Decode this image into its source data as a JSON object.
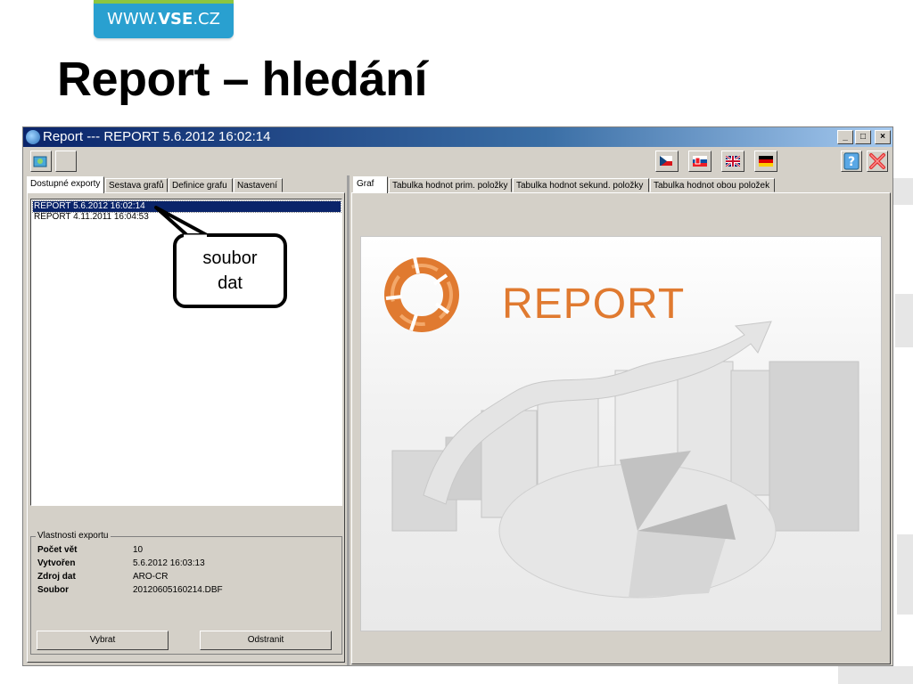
{
  "slide": {
    "logo_prefix": "WWW.",
    "logo_bold": "VSE",
    "logo_suffix": ".CZ",
    "title": "Report – hledání"
  },
  "window": {
    "title": "Report --- REPORT 5.6.2012 16:02:14",
    "controls": {
      "minimize": "_",
      "maximize": "□",
      "close": "×"
    }
  },
  "toolbar": {
    "flags": [
      "cz-flag-icon",
      "sk-flag-icon",
      "gb-flag-icon",
      "de-flag-icon"
    ],
    "help_icon": "help-icon",
    "exit_icon": "exit-icon"
  },
  "left_tabs": [
    "Dostupné exporty",
    "Sestava grafů",
    "Definice grafu",
    "Nastavení"
  ],
  "exports": [
    "REPORT 5.6.2012 16:02:14",
    "REPORT 4.11.2011 16:04:53"
  ],
  "selected_export_index": 0,
  "properties": {
    "group_title": "Vlastnosti exportu",
    "rows": [
      {
        "label": "Počet vět",
        "value": "10"
      },
      {
        "label": "Vytvořen",
        "value": "5.6.2012 16:03:13"
      },
      {
        "label": "Zdroj dat",
        "value": "ARO-CR"
      },
      {
        "label": "Soubor",
        "value": "20120605160214.DBF"
      }
    ]
  },
  "buttons": {
    "select": "Vybrat",
    "remove": "Odstranit"
  },
  "right_tabs": [
    "Graf",
    "Tabulka hodnot prim. položky",
    "Tabulka hodnot sekund. položky",
    "Tabulka hodnot obou položek"
  ],
  "splash": {
    "word": "REPORT"
  },
  "callout": {
    "line1": "soubor",
    "line2": "dat"
  },
  "colors": {
    "accent_orange": "#e07a30",
    "title_blue": "#0a246a",
    "logo_blue": "#29a0d0",
    "logo_green": "#8dc63f"
  }
}
